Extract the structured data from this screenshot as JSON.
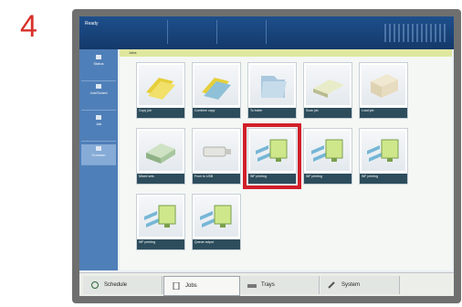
{
  "step_number": "4",
  "header": {
    "title": "Ready"
  },
  "sidebar": {
    "items": [
      {
        "label": "Status"
      },
      {
        "label": "Job/Sched"
      },
      {
        "label": "Job"
      },
      {
        "label": "Consum"
      }
    ]
  },
  "breadcrumb": "Jobs",
  "tiles": [
    {
      "label": "Copy job"
    },
    {
      "label": "Combine copy"
    },
    {
      "label": "To folder"
    },
    {
      "label": "Scan job"
    },
    {
      "label": "Load job"
    },
    {
      "label": "Mixed sets"
    },
    {
      "label": "From to USB"
    },
    {
      "label": "WF printing"
    },
    {
      "label": "WF printing"
    },
    {
      "label": "WF printing"
    },
    {
      "label": "WF printing"
    },
    {
      "label": "Queue output"
    }
  ],
  "bottom_tabs": [
    {
      "label": "Schedule",
      "icon": "clock-icon"
    },
    {
      "label": "Jobs",
      "icon": "document-icon"
    },
    {
      "label": "Trays",
      "icon": "tray-icon"
    },
    {
      "label": "System",
      "icon": "wrench-icon"
    }
  ],
  "colors": {
    "header": "#1e4f8c",
    "sidebar": "#4f7fb8",
    "highlight": "#d11f2a",
    "breadcrumb": "#dfe79e"
  }
}
